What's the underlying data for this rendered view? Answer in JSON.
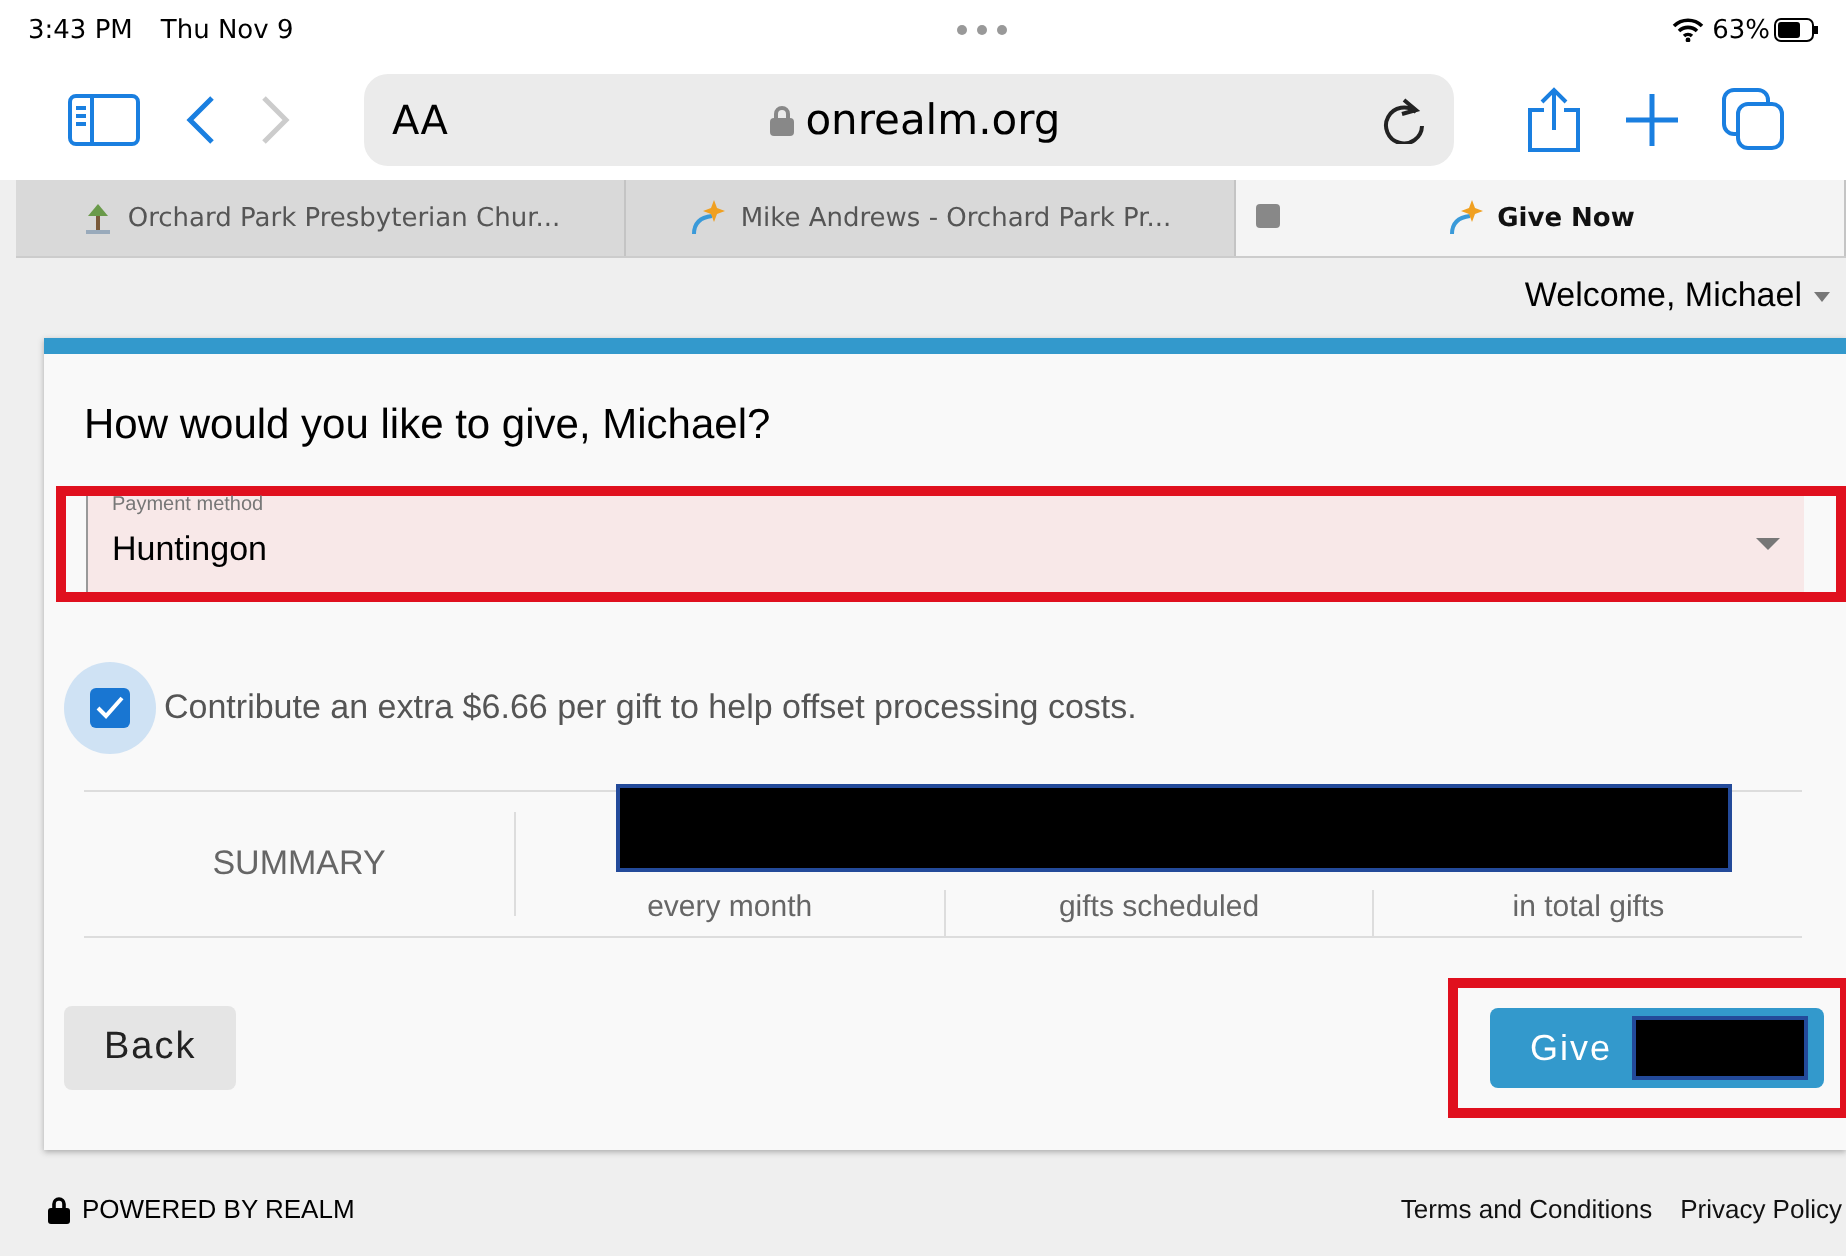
{
  "status_bar": {
    "time": "3:43 PM",
    "date": "Thu Nov 9",
    "battery": "63%"
  },
  "toolbar": {
    "text_size": "AA",
    "url": "onrealm.org"
  },
  "tabs": [
    {
      "title": "Orchard Park Presbyterian Chur...",
      "selected": false
    },
    {
      "title": "Mike Andrews - Orchard Park Pr...",
      "selected": false
    },
    {
      "title": "Give Now",
      "selected": true
    }
  ],
  "welcome": "Welcome, Michael",
  "form": {
    "heading": "How would you like to give, Michael?",
    "payment_label": "Payment method",
    "payment_value": "Huntingon",
    "extra_fee": {
      "label": "Contribute an extra $6.66 per gift to help offset processing costs.",
      "checked": true
    },
    "summary": {
      "title": "SUMMARY",
      "columns": [
        "every month",
        "gifts scheduled",
        "in total gifts"
      ]
    },
    "back": "Back",
    "give": "Give"
  },
  "footer": {
    "powered": "POWERED BY REALM",
    "links": [
      "Terms and Conditions",
      "Privacy Policy"
    ]
  }
}
